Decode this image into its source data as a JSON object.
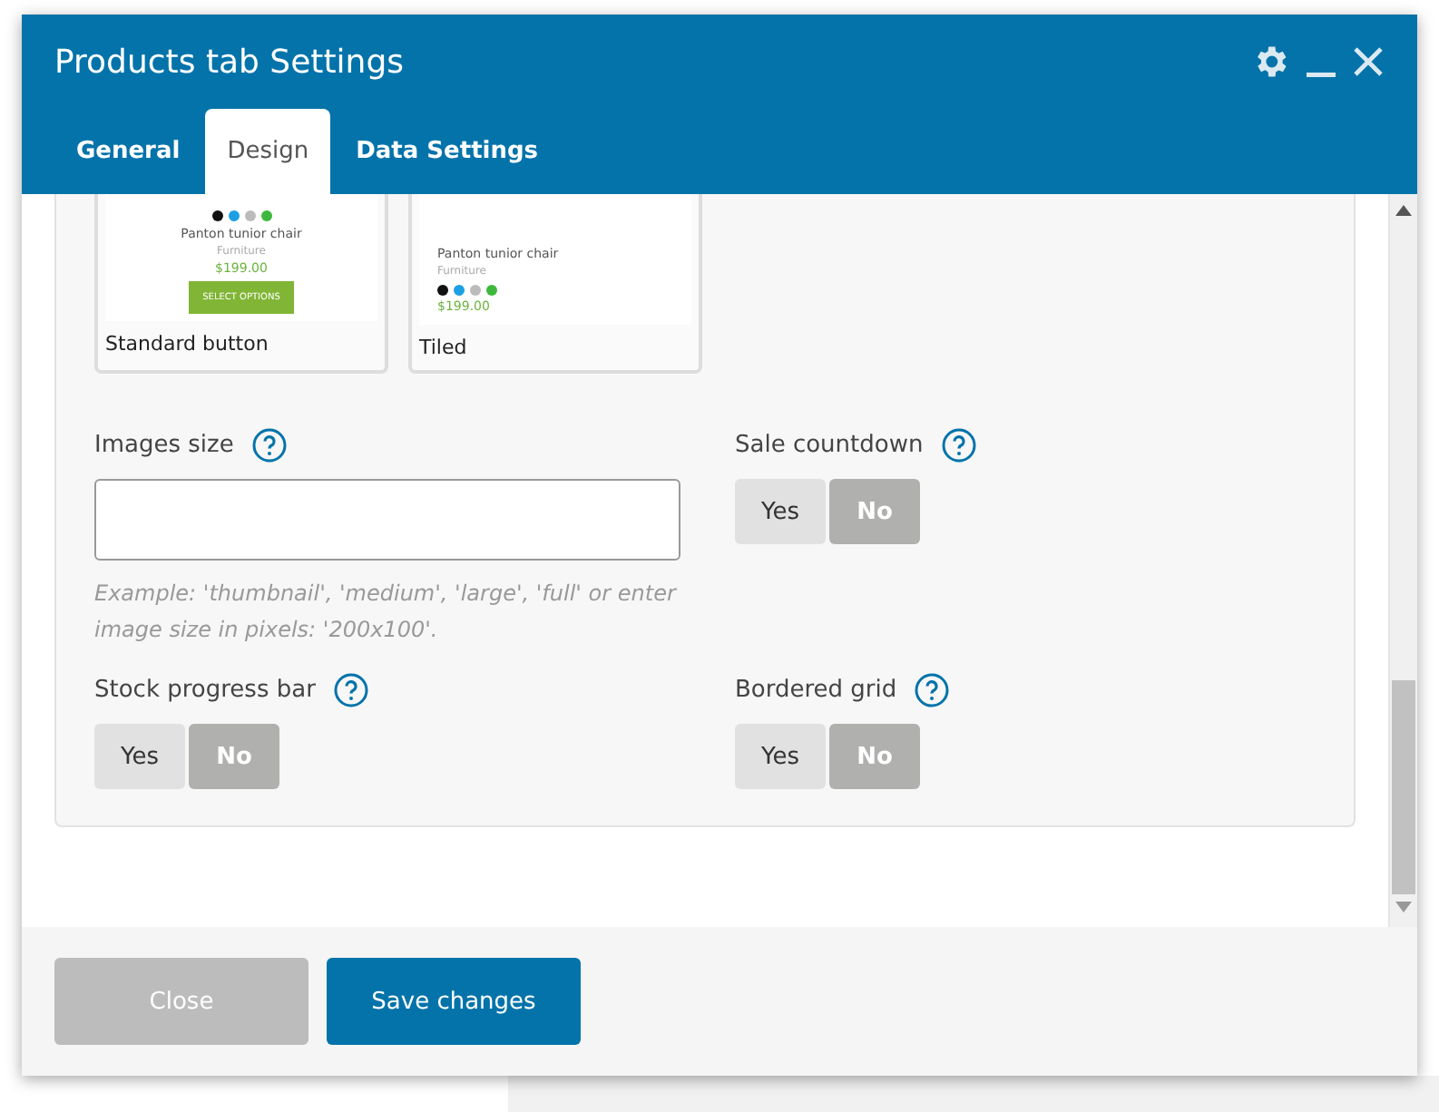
{
  "window": {
    "title": "Products tab Settings"
  },
  "tabs": [
    {
      "label": "General",
      "selected": false
    },
    {
      "label": "Design",
      "selected": true
    },
    {
      "label": "Data Settings",
      "selected": false
    }
  ],
  "layouts": [
    {
      "kind": "standard",
      "label": "Standard button",
      "product": "Panton tunior chair",
      "category": "Furniture",
      "price": "$199.00",
      "button": "SELECT OPTIONS",
      "swatches": [
        {
          "color": "#111111"
        },
        {
          "color": "#1ca0e3"
        },
        {
          "color": "#bbbbbb"
        },
        {
          "color": "#3db83d"
        }
      ]
    },
    {
      "kind": "tiled",
      "label": "Tiled",
      "product": "Panton tunior chair",
      "category": "Furniture",
      "price": "$199.00",
      "swatches": [
        {
          "color": "#111111"
        },
        {
          "color": "#1ca0e3"
        },
        {
          "color": "#bbbbbb"
        },
        {
          "color": "#3db83d"
        }
      ]
    }
  ],
  "fields": [
    {
      "kind": "input",
      "label": "Images size",
      "hint": "Example: 'thumbnail', 'medium', 'large', 'full' or enter image size in pixels: '200x100'."
    },
    {
      "kind": "toggle",
      "label": "Sale countdown",
      "options": [
        {
          "label": "Yes",
          "selected": false
        },
        {
          "label": "No",
          "selected": true
        }
      ]
    },
    {
      "kind": "toggle",
      "label": "Stock progress bar",
      "options": [
        {
          "label": "Yes",
          "selected": false
        },
        {
          "label": "No",
          "selected": true
        }
      ]
    },
    {
      "kind": "toggle",
      "label": "Bordered grid",
      "options": [
        {
          "label": "Yes",
          "selected": false
        },
        {
          "label": "No",
          "selected": true
        }
      ]
    }
  ],
  "buttons": [
    {
      "kind": "secondary",
      "label": "Close"
    },
    {
      "kind": "primary",
      "label": "Save changes"
    }
  ]
}
